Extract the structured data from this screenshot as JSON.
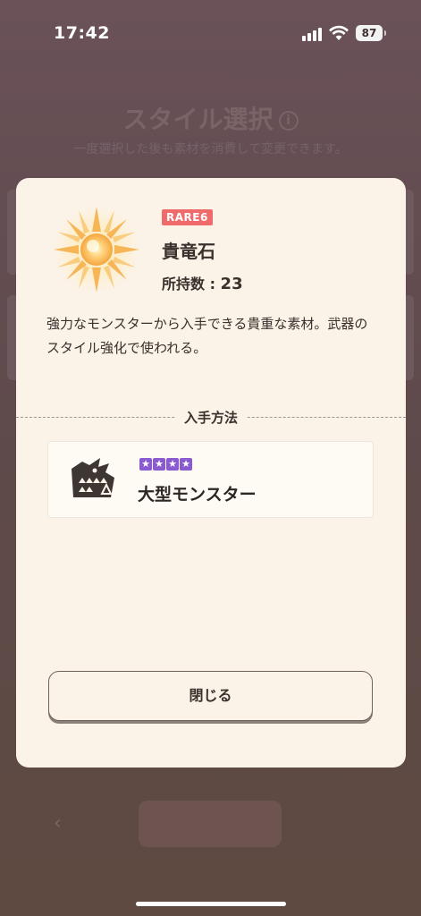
{
  "status_bar": {
    "time": "17:42",
    "battery": "87"
  },
  "background": {
    "title": "スタイル選択",
    "subtitle": "一度選択した後も素材を消費して変更できます。"
  },
  "item": {
    "rarity": "RARE6",
    "name": "貴竜石",
    "owned_label": "所持数 : ",
    "owned_count": "23",
    "description": "強力なモンスターから入手できる貴重な素材。武器のスタイル強化で使われる。"
  },
  "acquisition": {
    "section_label": "入手方法",
    "sources": [
      {
        "stars": 4,
        "name": "大型モンスター",
        "icon": "large-monster-icon"
      }
    ]
  },
  "close_label": "閉じる",
  "colors": {
    "rarity": "#ef6a6a",
    "star": "#8a5ad0",
    "modal_bg": "#fbf3e8"
  }
}
